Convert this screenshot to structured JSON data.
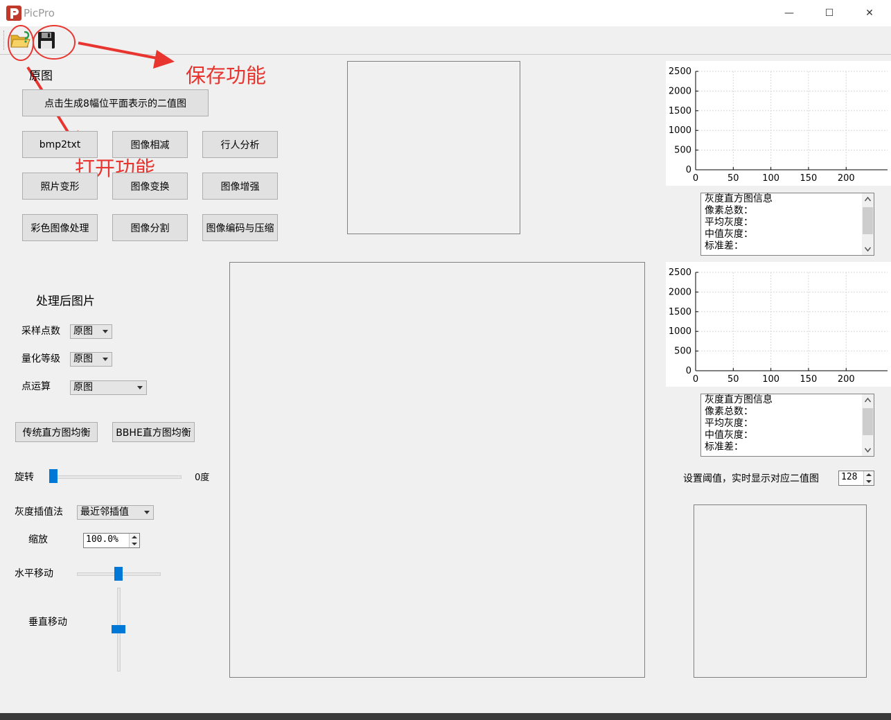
{
  "window": {
    "title": "PicPro",
    "minimize_glyph": "—",
    "maximize_glyph": "☐",
    "close_glyph": "✕"
  },
  "toolbar": {
    "open_icon": "folder-open-icon",
    "save_icon": "floppy-disk-icon"
  },
  "annotations": {
    "save": "保存功能",
    "open": "打开功能",
    "color": "#e8352f"
  },
  "left": {
    "original_label": "原图",
    "bitplane_button": "点击生成8幅位平面表示的二值图",
    "buttons": [
      "bmp2txt",
      "图像相减",
      "行人分析",
      "照片变形",
      "图像变换",
      "图像增强",
      "彩色图像处理",
      "图像分割",
      "图像编码与压缩"
    ],
    "processed_label": "处理后图片",
    "sampling": {
      "label": "采样点数",
      "value": "原图"
    },
    "quantization": {
      "label": "量化等级",
      "value": "原图"
    },
    "point_op": {
      "label": "点运算",
      "value": "原图"
    },
    "hist_eq_button": "传统直方图均衡",
    "behe_button": "BBHE直方图均衡",
    "rotate": {
      "label": "旋转",
      "value": "0度",
      "level": 0
    },
    "interp": {
      "label": "灰度插值法",
      "value": "最近邻插值"
    },
    "scale": {
      "label": "缩放",
      "value": "100.0%"
    },
    "hmove": {
      "label": "水平移动",
      "level": 0.5
    },
    "vmove": {
      "label": "垂直移动",
      "level": 0.5
    }
  },
  "right": {
    "hist_info": [
      "灰度直方图信息",
      "像素总数：",
      "平均灰度：",
      "中值灰度：",
      "标准差："
    ],
    "threshold": {
      "label": "设置阈值，实时显示对应二值图",
      "value": "128"
    }
  },
  "chart_data": [
    {
      "type": "bar",
      "title": "",
      "xlabel": "",
      "ylabel": "",
      "xlim": [
        0,
        255
      ],
      "ylim": [
        0,
        2500
      ],
      "xticks": [
        "0",
        "50",
        "100",
        "150",
        "200"
      ],
      "yticks": [
        "0",
        "500",
        "1000",
        "1500",
        "2000",
        "2500"
      ],
      "grid": true,
      "series": []
    },
    {
      "type": "bar",
      "title": "",
      "xlabel": "",
      "ylabel": "",
      "xlim": [
        0,
        255
      ],
      "ylim": [
        0,
        2500
      ],
      "xticks": [
        "0",
        "50",
        "100",
        "150",
        "200"
      ],
      "yticks": [
        "0",
        "500",
        "1000",
        "1500",
        "2000",
        "2500"
      ],
      "grid": true,
      "series": []
    }
  ]
}
